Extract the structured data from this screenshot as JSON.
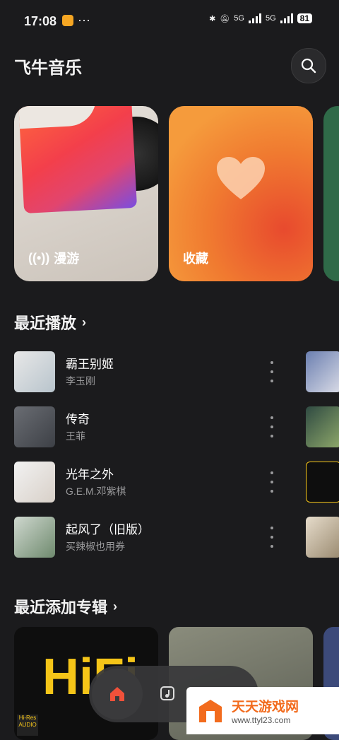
{
  "status_bar": {
    "time": "17:08",
    "dots": "···",
    "network1": "5G",
    "network2": "5G",
    "battery": "81"
  },
  "header": {
    "title": "飞牛音乐"
  },
  "cards": [
    {
      "label": "漫游"
    },
    {
      "label": "收藏"
    }
  ],
  "recent": {
    "title": "最近播放",
    "songs": [
      {
        "title": "霸王别姬",
        "artist": "李玉刚"
      },
      {
        "title": "传奇",
        "artist": "王菲"
      },
      {
        "title": "光年之外",
        "artist": "G.E.M.邓紫棋"
      },
      {
        "title": "起风了（旧版）",
        "artist": "买辣椒也用券"
      }
    ]
  },
  "albums": {
    "title": "最近添加专辑",
    "hifi_text": "HiFi",
    "hires_text": "Hi-Res AUDIO"
  },
  "watermark": {
    "main": "天天游戏网",
    "url": "www.ttyl23.com"
  },
  "colors": {
    "background": "#1b1b1d",
    "accent": "#f0513a",
    "fav_card": "#f07a30"
  }
}
